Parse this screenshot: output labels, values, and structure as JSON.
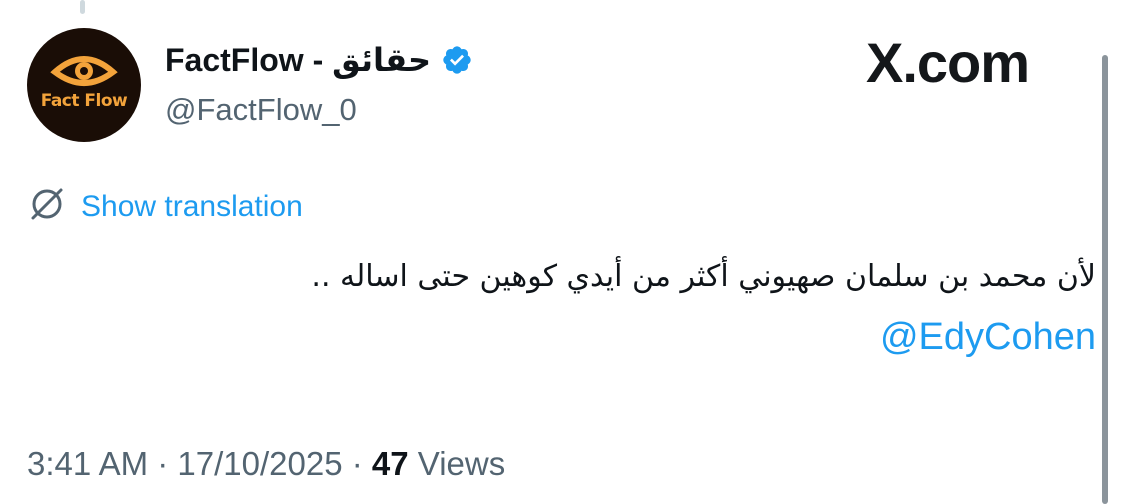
{
  "author": {
    "display_name": "FactFlow - حقائق",
    "handle": "@FactFlow_0",
    "avatar_text": "Fact Flow",
    "verified": true
  },
  "brand": {
    "label": "X.com"
  },
  "translation": {
    "label": "Show translation"
  },
  "tweet": {
    "text": "لأن محمد بن سلمان صهيوني أكثر من أيدي كوهين حتى اساله ..",
    "mention": "@EdyCohen"
  },
  "meta": {
    "time": "3:41 AM",
    "separator1": " · ",
    "date": "17/10/2025",
    "separator2": " · ",
    "views_count": "47",
    "views_label": " Views"
  },
  "colors": {
    "accent": "#1d9bf0",
    "text": "#0f1419",
    "muted": "#536471",
    "avatar_bg": "#1a0d06",
    "avatar_accent": "#f3a33b"
  }
}
